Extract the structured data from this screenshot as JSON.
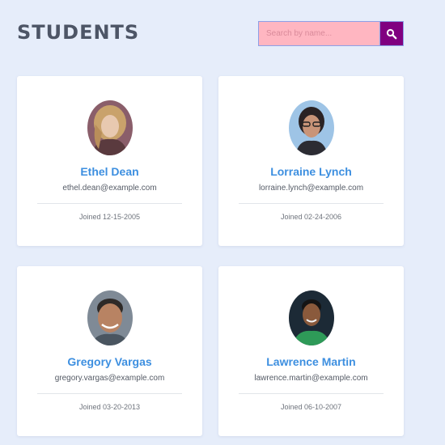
{
  "page": {
    "title": "STUDENTS"
  },
  "search": {
    "placeholder": "Search by name..."
  },
  "students": [
    {
      "name": "Ethel Dean",
      "email": "ethel.dean@example.com",
      "joined": "Joined 12-15-2005"
    },
    {
      "name": "Lorraine Lynch",
      "email": "lorraine.lynch@example.com",
      "joined": "Joined 02-24-2006"
    },
    {
      "name": "Gregory Vargas",
      "email": "gregory.vargas@example.com",
      "joined": "Joined 03-20-2013"
    },
    {
      "name": "Lawrence Martin",
      "email": "lawrence.martin@example.com",
      "joined": "Joined 06-10-2007"
    }
  ],
  "colors": {
    "background": "#e6edfa",
    "title": "#4d5566",
    "search_input": "#ffb6c1",
    "search_button": "#800080",
    "name_link": "#3d8fe0"
  },
  "icons": {
    "search": "search-icon"
  }
}
